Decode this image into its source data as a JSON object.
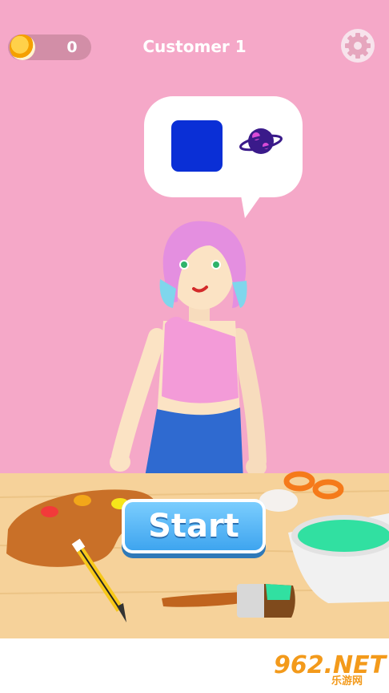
{
  "hud": {
    "coins": "0",
    "customer_label": "Customer 1",
    "coin_icon": "coin-icon",
    "settings_icon": "gear-icon"
  },
  "order": {
    "color_swatch": "#0a2fd6",
    "sticker_icon": "planet-icon"
  },
  "actions": {
    "start_label": "Start"
  },
  "watermark": {
    "main": "962.NET",
    "sub": "乐游网"
  },
  "colors": {
    "background": "#f5a8c8",
    "table": "#f6d29a",
    "accent_button": "#3aa2ee",
    "paint_bowl": "#31e0a1"
  }
}
